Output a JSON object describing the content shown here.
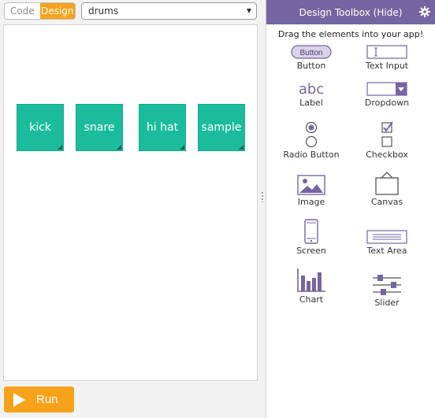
{
  "mode_toggle": {
    "code_label": "Code",
    "design_label": "Design"
  },
  "screen_select": {
    "value": "drums"
  },
  "app_screen": {
    "pads": [
      {
        "label": "kick"
      },
      {
        "label": "snare"
      },
      {
        "label": "hi hat"
      },
      {
        "label": "sample"
      }
    ],
    "pad_color": "#1abc9c"
  },
  "run_button": {
    "label": "Run",
    "color": "#f7a21b"
  },
  "toolbox": {
    "title": "Design Toolbox (Hide)",
    "hint": "Drag the elements into your app!",
    "header_color": "#7665a0",
    "icon_color": "#7665a0",
    "items": [
      {
        "label": "Button",
        "icon": "button-icon",
        "icon_text": "Button"
      },
      {
        "label": "Text Input",
        "icon": "text-input-icon"
      },
      {
        "label": "Label",
        "icon": "label-icon",
        "icon_text": "abc"
      },
      {
        "label": "Dropdown",
        "icon": "dropdown-icon"
      },
      {
        "label": "Radio Button",
        "icon": "radio-button-icon"
      },
      {
        "label": "Checkbox",
        "icon": "checkbox-icon"
      },
      {
        "label": "Image",
        "icon": "image-icon"
      },
      {
        "label": "Canvas",
        "icon": "canvas-icon"
      },
      {
        "label": "Screen",
        "icon": "screen-icon"
      },
      {
        "label": "Text Area",
        "icon": "text-area-icon"
      },
      {
        "label": "Chart",
        "icon": "chart-icon"
      },
      {
        "label": "Slider",
        "icon": "slider-icon"
      }
    ]
  }
}
